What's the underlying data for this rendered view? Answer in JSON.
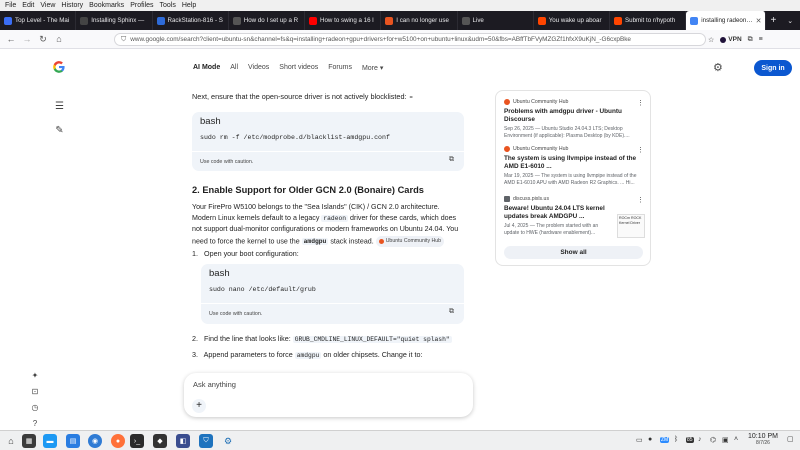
{
  "menubar": {
    "items": [
      "File",
      "Edit",
      "View",
      "History",
      "Bookmarks",
      "Profiles",
      "Tools",
      "Help"
    ]
  },
  "tabs": [
    {
      "label": "Top Level - The Mai",
      "color": "#3b6ef5"
    },
    {
      "label": "Installing Sphinx —",
      "color": "#333333"
    },
    {
      "label": "RackStation-816 - S",
      "color": "#2e6bd8"
    },
    {
      "label": "How do I set up a R",
      "color": "#444444"
    },
    {
      "label": "How to swing a 16 l",
      "color": "#ff0000"
    },
    {
      "label": "I can no longer use",
      "color": "#e95420"
    },
    {
      "label": "Live",
      "color": "#333333"
    },
    {
      "label": "You wake up aboar",
      "color": "#ff4500"
    },
    {
      "label": "Submit to r/hypoth",
      "color": "#ff4500"
    },
    {
      "label": "installing radeon gp",
      "color": "#4285f4",
      "active": true
    }
  ],
  "navbar": {
    "url": "www.google.com/search?client=ubuntu-sn&channel=fs&q=installing+radeon+gpu+drivers+for+w5100+on+ubuntu+linux&udm=50&fbs=ABffTbFVyMZGZf1hfxX9uKjN_-G6cxpBke",
    "vpn": "VPN"
  },
  "google": {
    "tabs": [
      "AI Mode",
      "All",
      "Videos",
      "Short videos",
      "Forums",
      "More"
    ],
    "signin": "Sign in"
  },
  "content": {
    "intro": "Next, ensure that the open-source driver is not actively blocklisted:",
    "code1": {
      "lang": "bash",
      "code": "sudo rm -f /etc/modprobe.d/blacklist-amdgpu.conf",
      "caution": "Use code with caution."
    },
    "heading": "2. Enable Support for Older GCN 2.0 (Bonaire) Cards",
    "para1": "Your FirePro W5100 belongs to the \"Sea Islands\" (CIK) / GCN 2.0 architecture. Modern Linux kernels default to a legacy",
    "para1_code": "radeon",
    "para1b": "driver for these cards, which does not support dual-monitor configurations or modern frameworks on Ubuntu 24.04. You need to force the kernel to use the",
    "para1_code2": "amdgpu",
    "para1c": "stack instead.",
    "chip": "Ubuntu Community Hub",
    "step1": "Open your boot configuration:",
    "code2": {
      "lang": "bash",
      "code": "sudo nano /etc/default/grub",
      "caution": "Use code with caution."
    },
    "step2_pre": "Find the line that looks like:",
    "step2_code": "GRUB_CMDLINE_LINUX_DEFAULT=\"quiet splash\"",
    "step3_pre": "Append parameters to force",
    "step3_code": "amdgpu",
    "step3_post": "on older chipsets. Change it to:",
    "step_nums": [
      "1.",
      "2.",
      "3."
    ]
  },
  "ask": {
    "placeholder": "Ask anything"
  },
  "sources": [
    {
      "hub": "Ubuntu Community Hub",
      "title": "Problems with amdgpu driver - Ubuntu Discourse",
      "snippet": "Sep 26, 2025 — Ubuntu Studio 24.04.3 LTS; Desktop Environment (if applicable): Plasma Desktop (by KDE)...."
    },
    {
      "hub": "Ubuntu Community Hub",
      "title": "The system is using llvmpipe instead of the AMD E1-6010 ...",
      "snippet": "Mar 19, 2025 — The system is using llvmpipe instead of the AMD E1-6010 APU with AMD Radeon R2 Graphics. ... Hi..."
    },
    {
      "hub": "discuss.pixls.us",
      "title": "Beware! Ubuntu 24.04 LTS kernel updates break AMDGPU ...",
      "snippet": "Jul 4, 2025 — The problem started with an update to HWE (hardware enablement)...",
      "thumb": "ROCm ROCK Kernel Driver"
    }
  ],
  "show_all": "Show all",
  "clock": {
    "time": "10:10 PM",
    "date": "8/7/26"
  },
  "tray_labels": [
    "ZM",
    "85"
  ]
}
